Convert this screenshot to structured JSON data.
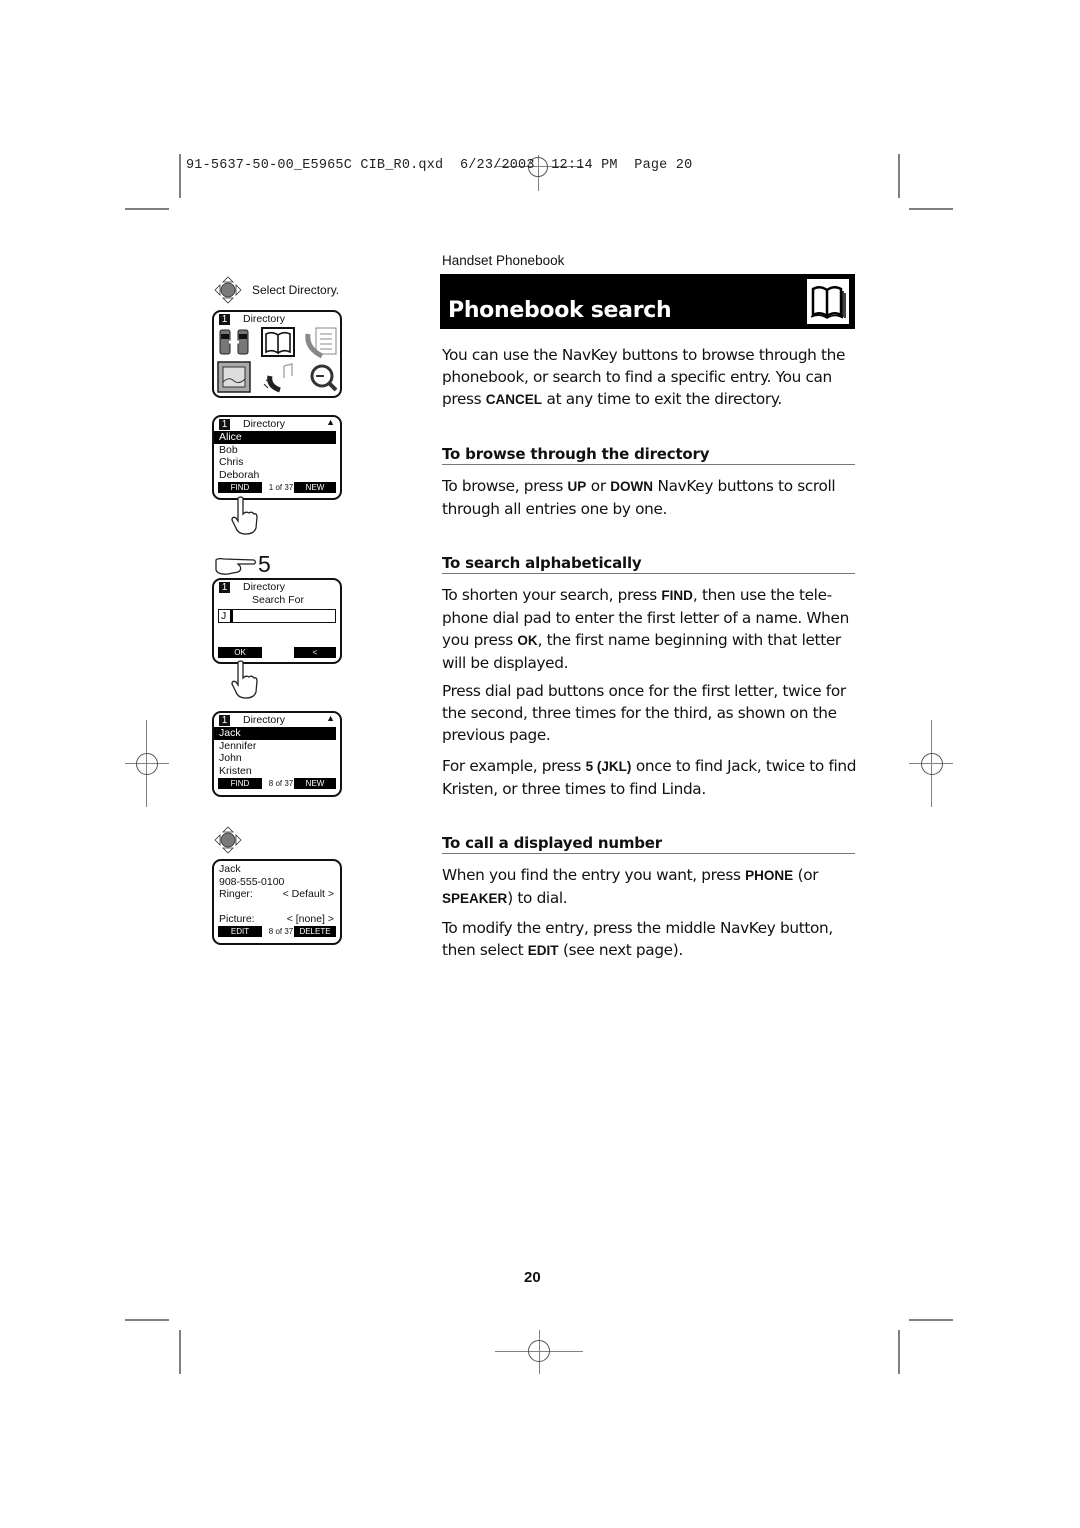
{
  "print_slug": "91-5637-50-00_E5965C CIB_R0.qxd  6/23/2003  12:14 PM  Page 20",
  "section_label": "Handset Phonebook",
  "title": "Phonebook search",
  "intro": {
    "before": "You can use the NavKey buttons to browse through the phonebook, or search to find a specific entry. You can press ",
    "key": "CANCEL",
    "after": " at any time to exit the directory."
  },
  "sections": [
    {
      "heading": "To browse through the directory",
      "paragraphs": [
        {
          "parts": [
            "To browse, press ",
            {
              "b": "UP"
            },
            " or ",
            {
              "b": "DOWN"
            },
            " NavKey buttons to scroll through all entries one by one."
          ]
        }
      ]
    },
    {
      "heading": "To search alphabetically",
      "paragraphs": [
        {
          "parts": [
            "To shorten your search, press ",
            {
              "b": "FIND"
            },
            ", then use the tele-phone dial pad to enter the first letter of a name. When you press ",
            {
              "b": "OK"
            },
            ", the first name beginning with that letter will be displayed."
          ]
        },
        {
          "parts": [
            "Press dial pad buttons once for the first letter, twice for the second, three times for the third, as shown on the previous page."
          ]
        },
        {
          "parts": [
            "For example, press ",
            {
              "b": "5 (JKL)"
            },
            " once to find Jack, twice to find Kristen, or three times to find Linda."
          ]
        }
      ]
    },
    {
      "heading": "To call a displayed number",
      "paragraphs": [
        {
          "parts": [
            "When you find the entry you want, press ",
            {
              "b": "PHONE"
            },
            " (or ",
            {
              "b": "SPEAKER"
            },
            ") to dial."
          ]
        },
        {
          "parts": [
            "To modify the entry, press the middle NavKey button, then select ",
            {
              "b": "EDIT"
            },
            " (see next page)."
          ]
        }
      ]
    }
  ],
  "illustrations": {
    "step1_caption": "Select Directory.",
    "menu_screen": {
      "number": "1",
      "title": "Directory",
      "icons": [
        "intercom-icon",
        "phonebook-icon",
        "call-log-icon",
        "picture-icon",
        "ringer-icon",
        "search-icon"
      ]
    },
    "list_screen_1": {
      "number": "1",
      "title": "Directory",
      "entries": [
        "Alice",
        "Bob",
        "Chris",
        "Deborah"
      ],
      "selected": "Alice",
      "left_soft": "FIND",
      "count": "1 of 37",
      "right_soft": "NEW"
    },
    "step_key": "5",
    "search_screen": {
      "number": "1",
      "title": "Directory",
      "subtitle": "Search For",
      "input_value": "J",
      "left_soft": "OK",
      "right_soft": "<"
    },
    "list_screen_2": {
      "number": "1",
      "title": "Directory",
      "entries": [
        "Jack",
        "Jennifer",
        "John",
        "Kristen"
      ],
      "selected": "Jack",
      "left_soft": "FIND",
      "count": "8 of 37",
      "right_soft": "NEW"
    },
    "detail_screen": {
      "name": "Jack",
      "phone": "908-555-0100",
      "ringer_label": "Ringer:",
      "ringer_value": "< Default >",
      "picture_label": "Picture:",
      "picture_value": "< [none] >",
      "left_soft": "EDIT",
      "count": "8 of 37",
      "right_soft": "DELETE"
    }
  },
  "page_number": "20"
}
